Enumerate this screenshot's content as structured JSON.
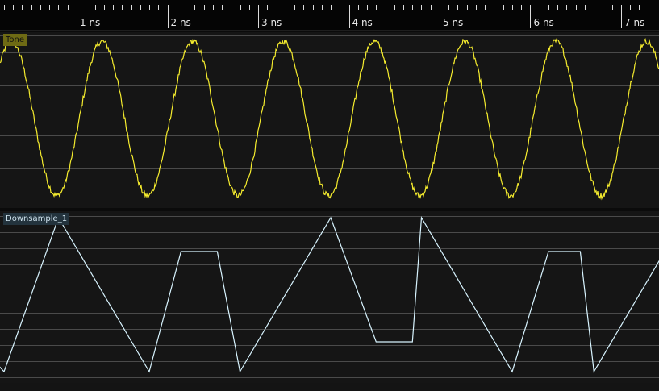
{
  "timeline": {
    "ticks": [
      "1 ns",
      "2 ns",
      "3 ns",
      "4 ns",
      "5 ns",
      "6 ns",
      "7 ns"
    ],
    "time_range_ns": [
      -0.8,
      7.35
    ]
  },
  "channels": [
    {
      "label": "Tone",
      "color": "#f5ec2e",
      "label_bg": "#6e6a14",
      "label_color": "#111111",
      "waveform": "sine",
      "period_ns": 1.0,
      "value_range": [
        -1,
        1
      ]
    },
    {
      "label": "Downsample_1",
      "color": "#d8f4ff",
      "label_bg": "#23333d",
      "label_color": "#cfe3ee",
      "waveform": "triangle-with-clipped-plateaus",
      "value_range": [
        -1,
        1
      ]
    }
  ],
  "colors": {
    "background": "#0b0b0b",
    "channel_bg": "#151515",
    "grid": "#4a4a4a",
    "center_line": "#e6e6e6",
    "ruler_bg": "#050505"
  }
}
